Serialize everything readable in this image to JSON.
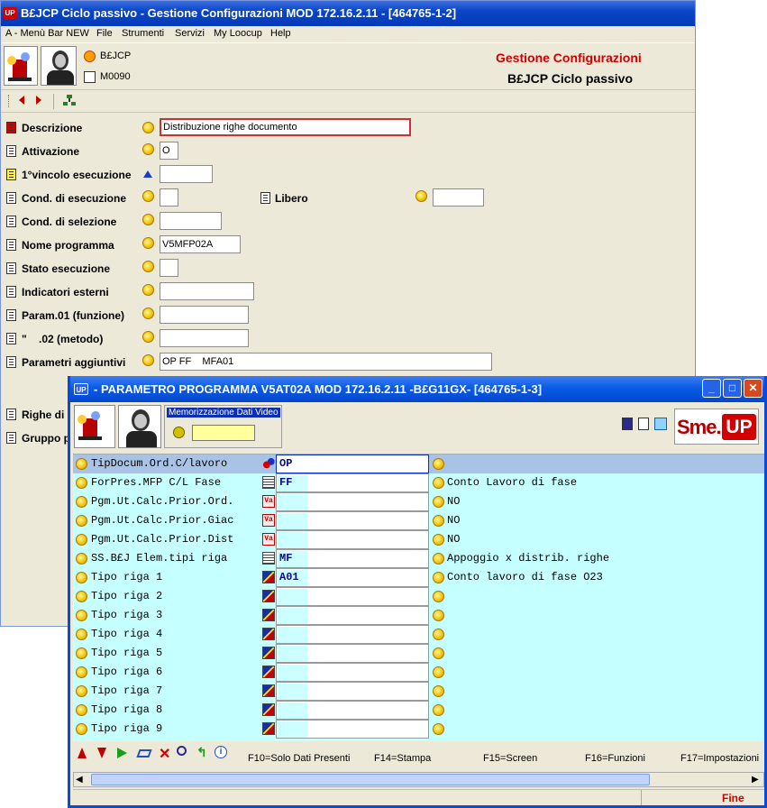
{
  "main_window": {
    "title": "B£JCP Ciclo passivo - Gestione Configurazioni MOD 172.16.2.11 - [464765-1-2]",
    "app_badge": "UP",
    "menu": [
      "A - Menù Bar NEW",
      "File",
      "Strumenti",
      "Servizi",
      "My Loocup",
      "Help"
    ],
    "header": {
      "code1": "B£JCP",
      "code2": "M0090",
      "title": "Gestione Configurazioni",
      "subtitle": "B£JCP Ciclo passivo"
    },
    "fields": {
      "descrizione": {
        "label": "Descrizione",
        "value": "Distribuzione righe documento"
      },
      "attivazione": {
        "label": "Attivazione",
        "value": "O"
      },
      "vincolo": {
        "label": "1°vincolo esecuzione",
        "value": ""
      },
      "cond_esec": {
        "label": "Cond. di esecuzione",
        "value": ""
      },
      "libero": {
        "label": "Libero",
        "value": ""
      },
      "cond_sel": {
        "label": "Cond. di selezione",
        "value": ""
      },
      "nome_prog": {
        "label": "Nome programma",
        "value": "V5MFP02A"
      },
      "stato": {
        "label": "Stato esecuzione",
        "value": ""
      },
      "indicatori": {
        "label": "Indicatori esterni",
        "value": ""
      },
      "param01": {
        "label": "Param.01 (funzione)",
        "value": ""
      },
      "param02": {
        "label": "\"    .02 (metodo)",
        "value": ""
      },
      "param_agg": {
        "label": "Parametri aggiuntivi",
        "value": "OP FF    MFA01"
      },
      "righe": {
        "label": "Righe di s"
      },
      "gruppo": {
        "label": "Gruppo p"
      }
    }
  },
  "dialog": {
    "title": "- PARAMETRO PROGRAMMA V5AT02A MOD 172.16.2.11 -B£G11GX- [464765-1-3]",
    "app_badge": "UP",
    "memo_label": "Memorizzazione Dati Video",
    "logo": {
      "sme": "Sme.",
      "up": "UP"
    },
    "rows": [
      {
        "name": "TipDocum.Ord.C/lavoro",
        "value": "OP",
        "desc": "",
        "icon": "ball-icon"
      },
      {
        "name": "ForPres.MFP C/L Fase",
        "value": "FF",
        "desc": "Conto Lavoro di fase",
        "icon": "table-icon"
      },
      {
        "name": "Pgm.Ut.Calc.Prior.Ord.",
        "value": "",
        "desc": "NO",
        "icon": "va-icon"
      },
      {
        "name": "Pgm.Ut.Calc.Prior.Giac",
        "value": "",
        "desc": "NO",
        "icon": "va-icon"
      },
      {
        "name": "Pgm.Ut.Calc.Prior.Dist",
        "value": "",
        "desc": "NO",
        "icon": "va-icon"
      },
      {
        "name": "SS.B£J Elem.tipi riga",
        "value": "MF",
        "desc": "Appoggio x distrib. righe",
        "icon": "table-icon"
      },
      {
        "name": "Tipo riga 1",
        "value": "A01",
        "desc": "Conto lavoro di fase O23",
        "icon": "xs-icon"
      },
      {
        "name": "Tipo riga 2",
        "value": "",
        "desc": "",
        "icon": "xs-icon"
      },
      {
        "name": "Tipo riga 3",
        "value": "",
        "desc": "",
        "icon": "xs-icon"
      },
      {
        "name": "Tipo riga 4",
        "value": "",
        "desc": "",
        "icon": "xs-icon"
      },
      {
        "name": "Tipo riga 5",
        "value": "",
        "desc": "",
        "icon": "xs-icon"
      },
      {
        "name": "Tipo riga 6",
        "value": "",
        "desc": "",
        "icon": "xs-icon"
      },
      {
        "name": "Tipo riga 7",
        "value": "",
        "desc": "",
        "icon": "xs-icon"
      },
      {
        "name": "Tipo riga 8",
        "value": "",
        "desc": "",
        "icon": "xs-icon"
      },
      {
        "name": "Tipo riga 9",
        "value": "",
        "desc": "",
        "icon": "xs-icon"
      }
    ],
    "function_keys": [
      "F10=Solo Dati Presenti",
      "F14=Stampa",
      "F15=Screen",
      "F16=Funzioni",
      "F17=Impostazioni"
    ],
    "status": "Fine"
  }
}
